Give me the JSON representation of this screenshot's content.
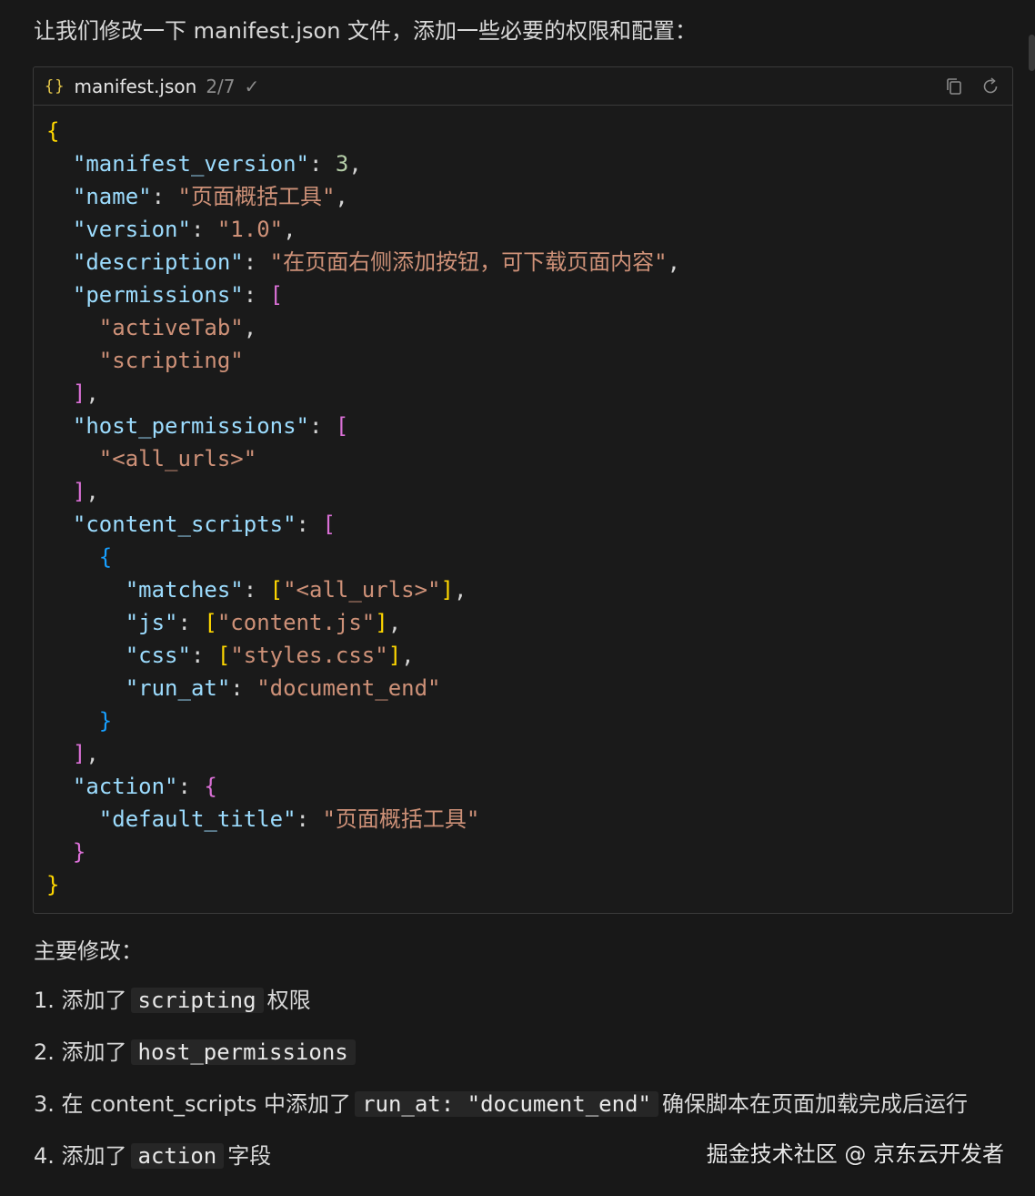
{
  "intro_text": "让我们修改一下 manifest.json 文件，添加一些必要的权限和配置：",
  "code_block": {
    "icon_glyph": "{}",
    "file_name": "manifest.json",
    "step": "2/7",
    "check_glyph": "✓",
    "lines": [
      [
        {
          "t": "{",
          "c": "b1"
        }
      ],
      [
        {
          "t": "  "
        },
        {
          "t": "\"manifest_version\"",
          "c": "k"
        },
        {
          "t": ": ",
          "c": "p"
        },
        {
          "t": "3",
          "c": "n"
        },
        {
          "t": ",",
          "c": "p"
        }
      ],
      [
        {
          "t": "  "
        },
        {
          "t": "\"name\"",
          "c": "k"
        },
        {
          "t": ": ",
          "c": "p"
        },
        {
          "t": "\"页面概括工具\"",
          "c": "s"
        },
        {
          "t": ",",
          "c": "p"
        }
      ],
      [
        {
          "t": "  "
        },
        {
          "t": "\"version\"",
          "c": "k"
        },
        {
          "t": ": ",
          "c": "p"
        },
        {
          "t": "\"1.0\"",
          "c": "s"
        },
        {
          "t": ",",
          "c": "p"
        }
      ],
      [
        {
          "t": "  "
        },
        {
          "t": "\"description\"",
          "c": "k"
        },
        {
          "t": ": ",
          "c": "p"
        },
        {
          "t": "\"在页面右侧添加按钮，可下载页面内容\"",
          "c": "s"
        },
        {
          "t": ",",
          "c": "p"
        }
      ],
      [
        {
          "t": "  "
        },
        {
          "t": "\"permissions\"",
          "c": "k"
        },
        {
          "t": ": ",
          "c": "p"
        },
        {
          "t": "[",
          "c": "b2"
        }
      ],
      [
        {
          "t": "    "
        },
        {
          "t": "\"activeTab\"",
          "c": "s"
        },
        {
          "t": ",",
          "c": "p"
        }
      ],
      [
        {
          "t": "    "
        },
        {
          "t": "\"scripting\"",
          "c": "s"
        }
      ],
      [
        {
          "t": "  "
        },
        {
          "t": "]",
          "c": "b2"
        },
        {
          "t": ",",
          "c": "p"
        }
      ],
      [
        {
          "t": "  "
        },
        {
          "t": "\"host_permissions\"",
          "c": "k"
        },
        {
          "t": ": ",
          "c": "p"
        },
        {
          "t": "[",
          "c": "b2"
        }
      ],
      [
        {
          "t": "    "
        },
        {
          "t": "\"<all_urls>\"",
          "c": "s"
        }
      ],
      [
        {
          "t": "  "
        },
        {
          "t": "]",
          "c": "b2"
        },
        {
          "t": ",",
          "c": "p"
        }
      ],
      [
        {
          "t": "  "
        },
        {
          "t": "\"content_scripts\"",
          "c": "k"
        },
        {
          "t": ": ",
          "c": "p"
        },
        {
          "t": "[",
          "c": "b2"
        }
      ],
      [
        {
          "t": "    "
        },
        {
          "t": "{",
          "c": "b3"
        }
      ],
      [
        {
          "t": "      "
        },
        {
          "t": "\"matches\"",
          "c": "k"
        },
        {
          "t": ": ",
          "c": "p"
        },
        {
          "t": "[",
          "c": "b1"
        },
        {
          "t": "\"<all_urls>\"",
          "c": "s"
        },
        {
          "t": "]",
          "c": "b1"
        },
        {
          "t": ",",
          "c": "p"
        }
      ],
      [
        {
          "t": "      "
        },
        {
          "t": "\"js\"",
          "c": "k"
        },
        {
          "t": ": ",
          "c": "p"
        },
        {
          "t": "[",
          "c": "b1"
        },
        {
          "t": "\"content.js\"",
          "c": "s"
        },
        {
          "t": "]",
          "c": "b1"
        },
        {
          "t": ",",
          "c": "p"
        }
      ],
      [
        {
          "t": "      "
        },
        {
          "t": "\"css\"",
          "c": "k"
        },
        {
          "t": ": ",
          "c": "p"
        },
        {
          "t": "[",
          "c": "b1"
        },
        {
          "t": "\"styles.css\"",
          "c": "s"
        },
        {
          "t": "]",
          "c": "b1"
        },
        {
          "t": ",",
          "c": "p"
        }
      ],
      [
        {
          "t": "      "
        },
        {
          "t": "\"run_at\"",
          "c": "k"
        },
        {
          "t": ": ",
          "c": "p"
        },
        {
          "t": "\"document_end\"",
          "c": "s"
        }
      ],
      [
        {
          "t": "    "
        },
        {
          "t": "}",
          "c": "b3"
        }
      ],
      [
        {
          "t": "  "
        },
        {
          "t": "]",
          "c": "b2"
        },
        {
          "t": ",",
          "c": "p"
        }
      ],
      [
        {
          "t": "  "
        },
        {
          "t": "\"action\"",
          "c": "k"
        },
        {
          "t": ": ",
          "c": "p"
        },
        {
          "t": "{",
          "c": "b2"
        }
      ],
      [
        {
          "t": "    "
        },
        {
          "t": "\"default_title\"",
          "c": "k"
        },
        {
          "t": ": ",
          "c": "p"
        },
        {
          "t": "\"页面概括工具\"",
          "c": "s"
        }
      ],
      [
        {
          "t": "  "
        },
        {
          "t": "}",
          "c": "b2"
        }
      ],
      [
        {
          "t": "}",
          "c": "b1"
        }
      ]
    ]
  },
  "summary": {
    "heading": "主要修改：",
    "items": [
      {
        "parts": [
          {
            "t": "1. 添加了"
          },
          {
            "t": "scripting",
            "code": true
          },
          {
            "t": "权限"
          }
        ]
      },
      {
        "parts": [
          {
            "t": "2. 添加了"
          },
          {
            "t": "host_permissions",
            "code": true
          }
        ]
      },
      {
        "parts": [
          {
            "t": "3. 在 content_scripts 中添加了"
          },
          {
            "t": "run_at: \"document_end\"",
            "code": true
          },
          {
            "t": "确保脚本在页面加载完成后运行"
          }
        ]
      },
      {
        "parts": [
          {
            "t": "4. 添加了"
          },
          {
            "t": "action",
            "code": true
          },
          {
            "t": "字段"
          }
        ]
      }
    ]
  },
  "watermark": "掘金技术社区 @ 京东云开发者",
  "theme": {
    "background": "#181818",
    "key_color": "#9cdcfe",
    "string_color": "#ce9178",
    "number_color": "#b5cea8",
    "bracket_gold": "#ffd700",
    "bracket_purple": "#da70d6",
    "bracket_blue": "#179fff"
  },
  "icons": {
    "copy": "copy-icon",
    "regenerate": "refresh-icon",
    "check": "check-icon",
    "json": "json-file-icon"
  }
}
